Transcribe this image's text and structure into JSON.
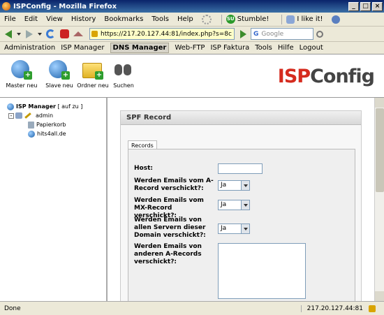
{
  "window": {
    "title": "ISPConfig - Mozilla Firefox"
  },
  "menubar": {
    "items": [
      "File",
      "Edit",
      "View",
      "History",
      "Bookmarks",
      "Tools",
      "Help"
    ],
    "stumble": "Stumble!",
    "ilike": "I like it!"
  },
  "navbar": {
    "url": "https://217.20.127.44:81/index.php?s=8c",
    "search_placeholder": "Google",
    "search_logo": "G"
  },
  "appnav": {
    "items": [
      "Administration",
      "ISP Manager",
      "DNS Manager",
      "Web-FTP",
      "ISP Faktura",
      "Tools",
      "Hilfe",
      "Logout"
    ],
    "active": "DNS Manager"
  },
  "tools": {
    "master": "Master neu",
    "slave": "Slave neu",
    "ordner": "Ordner neu",
    "suchen": "Suchen",
    "plus": "+"
  },
  "logo": {
    "isp": "ISP",
    "config": "Config"
  },
  "tree": {
    "root": "ISP Manager",
    "root_links": "[ auf  zu ]",
    "admin": "admin",
    "papierkorb": "Papierkorb",
    "domain": "hits4all.de",
    "minus": "-"
  },
  "panel": {
    "title": "SPF Record",
    "tab": "Records",
    "fields": {
      "host": {
        "label": "Host:",
        "value": ""
      },
      "a_record": {
        "label": "Werden Emails vom A-Record verschickt?:",
        "value": "Ja"
      },
      "mx_record": {
        "label": "Werden Emails vom MX-Record verschickt?:",
        "value": "Ja"
      },
      "all_servers": {
        "label": "Werden Emails von allen Servern dieser Domain verschickt?:",
        "value": "Ja"
      },
      "other_a": {
        "label": "Werden Emails von anderen A-Records verschickt?:",
        "value": ""
      }
    }
  },
  "status": {
    "text": "Done",
    "ip": "217.20.127.44:81"
  },
  "colors": {
    "logo_red": "#d52b1e",
    "titlebar": "#0a246a"
  }
}
